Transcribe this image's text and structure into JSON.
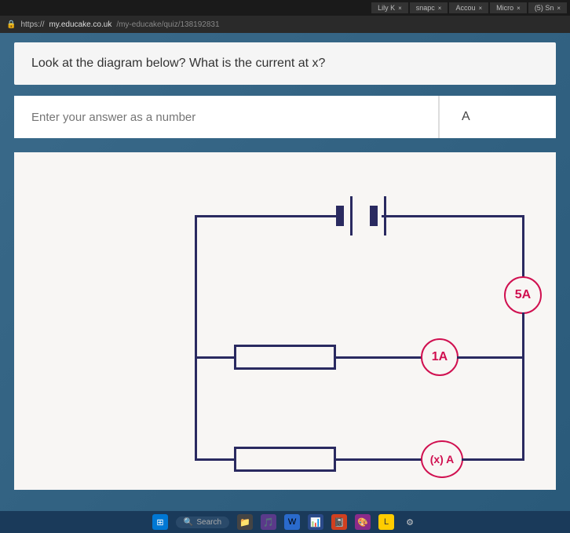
{
  "tabs": [
    {
      "label": "Lily K",
      "icon": ""
    },
    {
      "label": "snapc",
      "icon": ""
    },
    {
      "label": "Accou",
      "icon": ""
    },
    {
      "label": "Micro",
      "icon": ""
    },
    {
      "label": "(5) Sn",
      "icon": ""
    }
  ],
  "url": {
    "domain": "my.educake.co.uk",
    "path": "/my-educake/quiz/138192831",
    "full_prefix": "https://"
  },
  "question": {
    "text": "Look at the diagram below? What is the current at x?"
  },
  "answer": {
    "placeholder": "Enter your answer as a number",
    "unit": "A"
  },
  "circuit": {
    "ammeter_5a": "5A",
    "ammeter_1a": "1A",
    "ammeter_x": "(x) A"
  },
  "taskbar": {
    "search": "Search"
  }
}
